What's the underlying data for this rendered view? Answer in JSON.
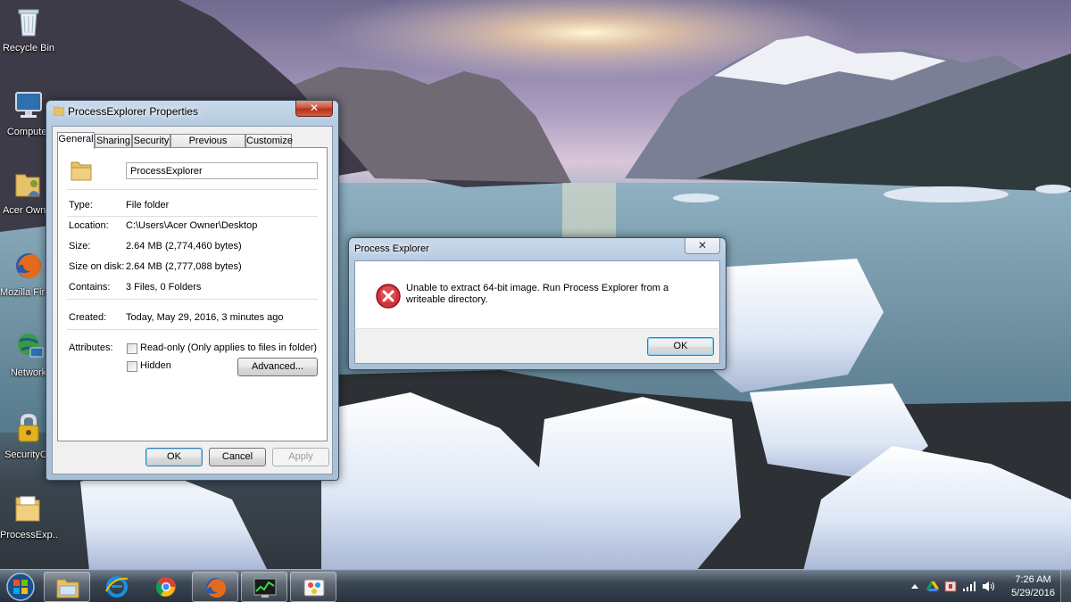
{
  "desktop": {
    "icons": [
      {
        "label": "Recycle Bin",
        "icon": "recycle-bin-icon"
      },
      {
        "label": "Computer",
        "icon": "computer-icon"
      },
      {
        "label": "Acer Owner",
        "icon": "user-folder-icon"
      },
      {
        "label": "Mozilla Firefox",
        "icon": "firefox-icon"
      },
      {
        "label": "Network",
        "icon": "network-icon"
      },
      {
        "label": "SecurityCh",
        "icon": "security-lock-icon"
      },
      {
        "label": "ProcessExp...",
        "icon": "folder-icon"
      }
    ]
  },
  "properties": {
    "title": "ProcessExplorer Properties",
    "tabs": [
      {
        "label": "General",
        "active": true
      },
      {
        "label": "Sharing"
      },
      {
        "label": "Security"
      },
      {
        "label": "Previous Versions"
      },
      {
        "label": "Customize"
      }
    ],
    "name": "ProcessExplorer",
    "rows": {
      "type": {
        "k": "Type:",
        "v": "File folder"
      },
      "location": {
        "k": "Location:",
        "v": "C:\\Users\\Acer Owner\\Desktop"
      },
      "size": {
        "k": "Size:",
        "v": "2.64 MB (2,774,460 bytes)"
      },
      "size_on_disk": {
        "k": "Size on disk:",
        "v": "2.64 MB (2,777,088 bytes)"
      },
      "contains": {
        "k": "Contains:",
        "v": "3 Files, 0 Folders"
      },
      "created": {
        "k": "Created:",
        "v": "Today, May 29, 2016, 3 minutes ago"
      }
    },
    "attributes_label": "Attributes:",
    "readonly_label": "Read-only (Only applies to files in folder)",
    "hidden_label": "Hidden",
    "advanced_label": "Advanced...",
    "ok_label": "OK",
    "cancel_label": "Cancel",
    "apply_label": "Apply",
    "close_glyph": "✕"
  },
  "message": {
    "title": "Process Explorer",
    "text": "Unable to extract 64-bit image. Run Process Explorer from a writeable directory.",
    "ok_label": "OK",
    "close_glyph": "✕"
  },
  "taskbar": {
    "pinned": [
      "start-orb",
      "explorer-icon",
      "internet-explorer-icon",
      "chrome-icon",
      "firefox-icon",
      "process-explorer-icon",
      "paint-icon"
    ],
    "clock_time": "7:26 AM",
    "clock_date": "5/29/2016"
  }
}
